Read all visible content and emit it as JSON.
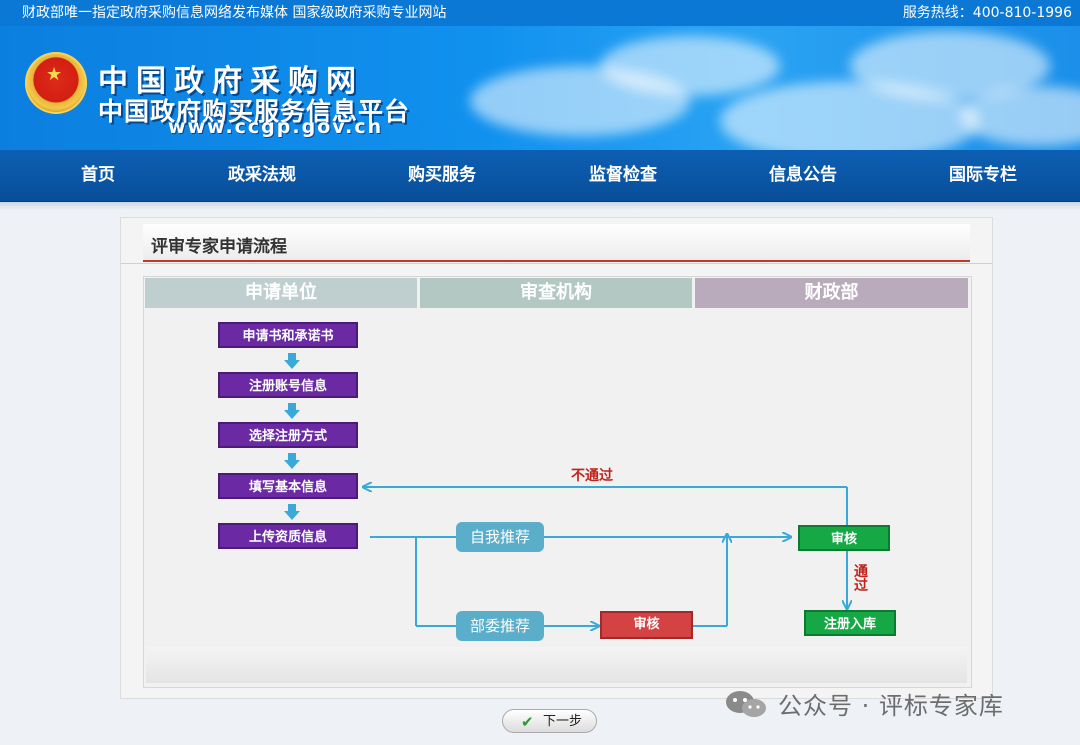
{
  "topbar": {
    "slogan": "财政部唯一指定政府采购信息网络发布媒体 国家级政府采购专业网站",
    "hotline": "服务热线：400-810-1996"
  },
  "banner": {
    "title": "中国政府采购网",
    "subtitle": "中国政府购买服务信息平台",
    "url": "www.ccgp.gov.cn"
  },
  "nav": {
    "items": [
      "首页",
      "政采法规",
      "购买服务",
      "监督检查",
      "信息公告",
      "国际专栏"
    ]
  },
  "panel": {
    "title": "评审专家申请流程"
  },
  "flow": {
    "columns": [
      {
        "label": "申请单位",
        "color": "#bfcfcf"
      },
      {
        "label": "审查机构",
        "color": "#b3c8c3"
      },
      {
        "label": "财政部",
        "color": "#b9abbb"
      }
    ],
    "steps": [
      "申请书和承诺书",
      "注册账号信息",
      "选择注册方式",
      "填写基本信息",
      "上传资质信息"
    ],
    "self_recommend": "自我推荐",
    "ministry_recommend": "部委推荐",
    "review_org": "审核",
    "review_mof": "审核",
    "register": "注册入库",
    "fail": "不通过",
    "pass": "通过"
  },
  "next_button": "下一步",
  "watermark": "公众号 · 评标专家库"
}
